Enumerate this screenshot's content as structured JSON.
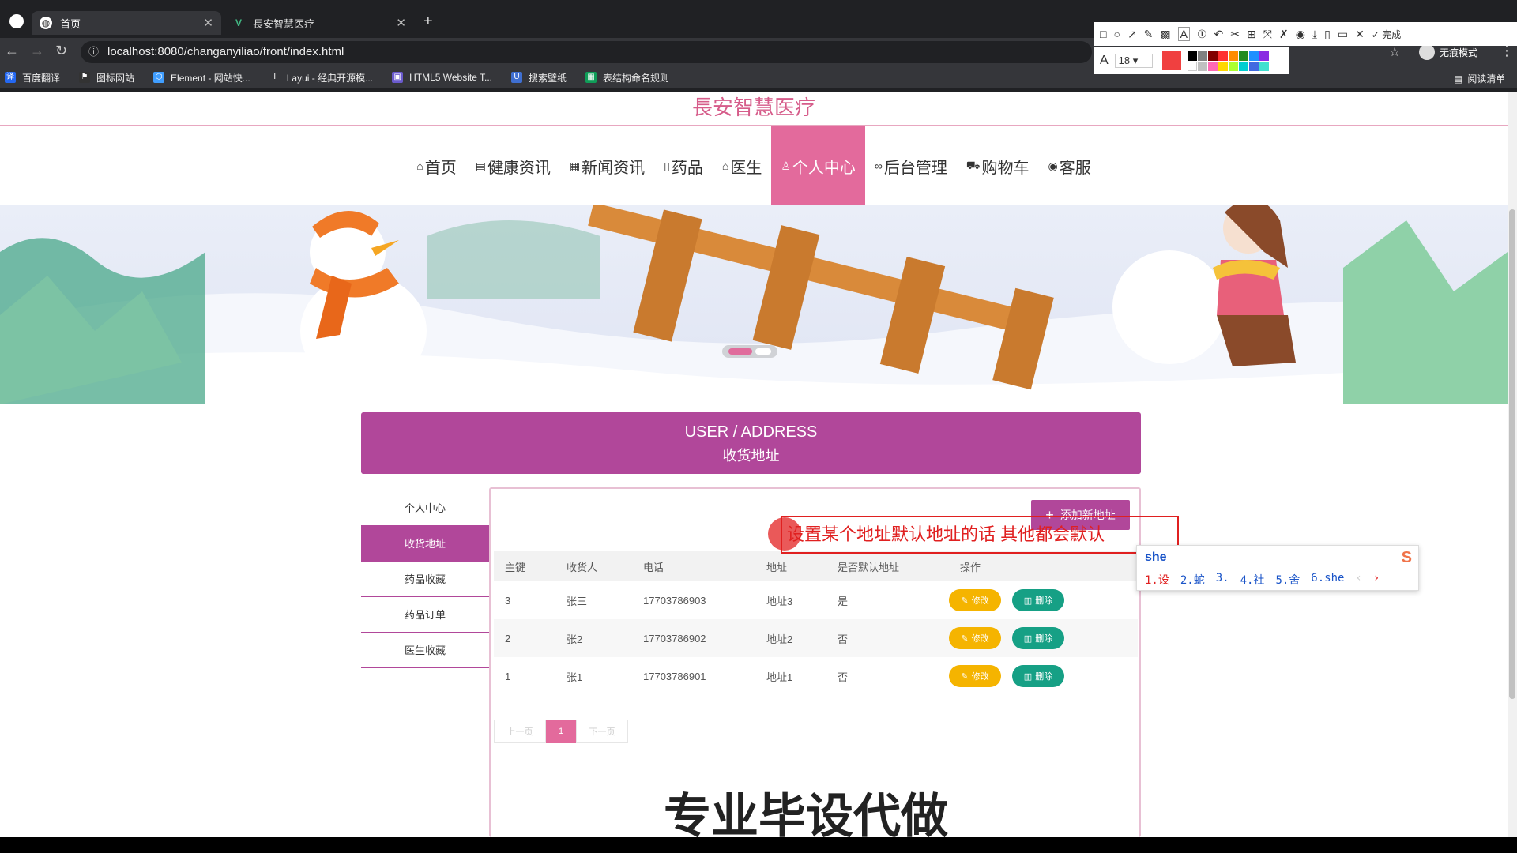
{
  "browser": {
    "tabs": [
      {
        "title": "首页",
        "active": true
      },
      {
        "title": "長安智慧医疗",
        "active": false
      }
    ],
    "new_tab": "+",
    "url": "localhost:8080/changanyiliao/front/index.html",
    "bookmarks": [
      "百度翻译",
      "图标网站",
      "Element - 网站快...",
      "Layui - 经典开源模...",
      "HTML5 Website T...",
      "搜索壁纸",
      "表结构命名规则"
    ],
    "incognito_label": "无痕模式",
    "reading_list": "阅读清单"
  },
  "annotation_toolbar": {
    "font_label": "A",
    "font_size": "18",
    "done_label": "完成",
    "selected_color": "#f04040"
  },
  "site": {
    "title": "長安智慧医疗",
    "nav": [
      {
        "label": "首页",
        "icon": "⌂"
      },
      {
        "label": "健康资讯",
        "icon": "▤"
      },
      {
        "label": "新闻资讯",
        "icon": "▦"
      },
      {
        "label": "药品",
        "icon": "▯"
      },
      {
        "label": "医生",
        "icon": "⌂"
      },
      {
        "label": "个人中心",
        "icon": "♙",
        "active": true
      },
      {
        "label": "后台管理",
        "icon": "∞"
      },
      {
        "label": "购物车",
        "icon": "⛟"
      },
      {
        "label": "客服",
        "icon": "◉"
      }
    ]
  },
  "section": {
    "title_en": "USER / ADDRESS",
    "title_cn": "收货地址"
  },
  "sidebar": {
    "items": [
      {
        "label": "个人中心",
        "active": false
      },
      {
        "label": "收货地址",
        "active": true
      },
      {
        "label": "药品收藏",
        "active": false
      },
      {
        "label": "药品订单",
        "active": false
      },
      {
        "label": "医生收藏",
        "active": false
      }
    ]
  },
  "address": {
    "add_button": "添加新地址",
    "columns": [
      "主键",
      "收货人",
      "电话",
      "地址",
      "是否默认地址",
      "操作"
    ],
    "rows": [
      {
        "id": "3",
        "name": "张三",
        "phone": "17703786903",
        "address": "地址3",
        "default": "是"
      },
      {
        "id": "2",
        "name": "张2",
        "phone": "17703786902",
        "address": "地址2",
        "default": "否"
      },
      {
        "id": "1",
        "name": "张1",
        "phone": "17703786901",
        "address": "地址1",
        "default": "否"
      }
    ],
    "edit_label": "修改",
    "delete_label": "删除",
    "pager": {
      "prev": "上一页",
      "current": "1",
      "next": "下一页"
    }
  },
  "overlay": {
    "annotation_text": "设置某个地址默认地址的话 其他都会默认",
    "watermark": "专业毕设代做"
  },
  "ime": {
    "input": "she",
    "candidates": [
      "1.设",
      "2.蛇",
      "3.",
      "4.社",
      "5.舍",
      "6.she"
    ]
  }
}
